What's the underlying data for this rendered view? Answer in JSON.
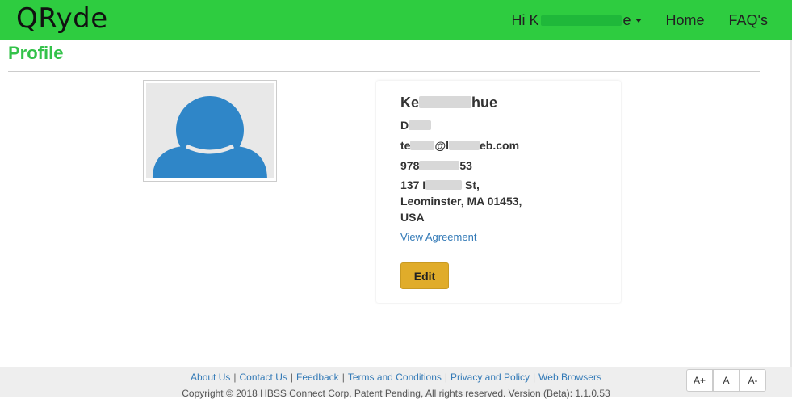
{
  "navbar": {
    "brand": "QRyde",
    "user_greeting_start": "Hi K",
    "user_greeting_end": "e",
    "home": "Home",
    "faq": "FAQ's"
  },
  "page": {
    "title": "Profile"
  },
  "profile": {
    "name_start": "Ke",
    "name_end": "hue",
    "line1_start": "D",
    "email_start": "te",
    "email_mid": "@l",
    "email_end": "eb.com",
    "phone_start": "978",
    "phone_end": "53",
    "address_start": "137 I",
    "address_end": " St,",
    "address_line2": "Leominster, MA 01453,",
    "address_line3": "USA",
    "agreement_link": "View Agreement",
    "edit_button": "Edit"
  },
  "footer": {
    "links": [
      "About Us",
      "Contact Us",
      "Feedback",
      "Terms and Conditions",
      "Privacy and Policy",
      "Web Browsers"
    ],
    "copyright": "Copyright © 2018 HBSS Connect Corp, Patent Pending, All rights reserved. Version (Beta): 1.1.0.53",
    "font_controls": [
      "A+",
      "A",
      "A-"
    ]
  },
  "colors": {
    "navbar": "#2ecc40",
    "title": "#33c24a",
    "avatar": "#2f86c8",
    "edit_button": "#e0ac2a",
    "link": "#337ab7"
  }
}
